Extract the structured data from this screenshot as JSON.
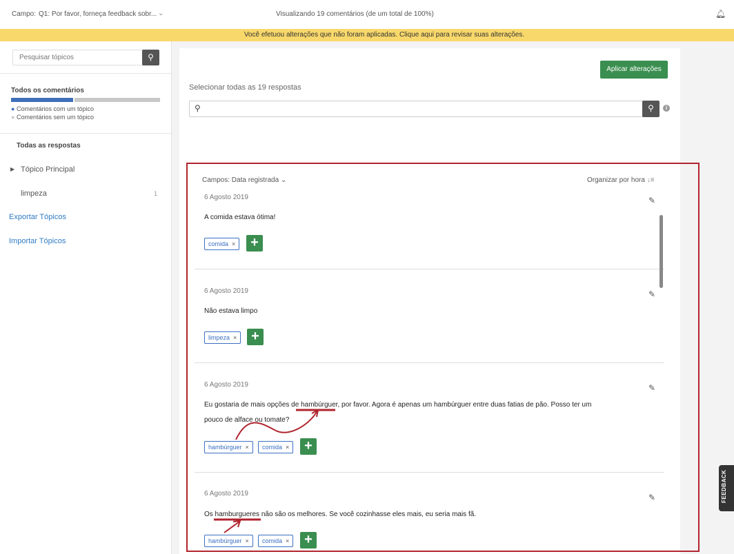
{
  "topbar": {
    "field_label": "Campo:",
    "field_value": "Q1: Por favor, forneça feedback sobr...",
    "viewing": "Visualizando 19 comentários (de um total de 100%)"
  },
  "banner": "Você efetuou alterações que não foram aplicadas. Clique aqui para revisar suas alterações.",
  "sidebar": {
    "search_placeholder": "Pesquisar tópicos",
    "all_comments": "Todos os comentários",
    "legend_with": "Comentários com um tópico",
    "legend_without": "Comentários sem um tópico",
    "coverage_percent": 50,
    "all_responses": "Todas as respostas",
    "main_topic": "Tópico Principal",
    "topics": [
      {
        "label": "limpeza",
        "count": "1"
      }
    ],
    "export": "Exportar Tópicos",
    "import": "Importar Tópicos"
  },
  "main": {
    "apply": "Aplicar alterações",
    "select_all": "Selecionar todas as 19 respostas",
    "fields": "Campos: Data registrada",
    "sort": "Organizar por hora",
    "comments": [
      {
        "date": "6 Agosto 2019",
        "text": "A comida estava ótima!",
        "tags": [
          "comida"
        ]
      },
      {
        "date": "6 Agosto 2019",
        "text": "Não estava limpo",
        "tags": [
          "limpeza"
        ]
      },
      {
        "date": "6 Agosto 2019",
        "text": "Eu gostaria de mais opções de hambúrguer, por favor. Agora é apenas um hambúrguer entre duas fatias de pão. Posso ter um pouco de alface ou tomate?",
        "tags": [
          "hambúrguer",
          "comida"
        ]
      },
      {
        "date": "6 Agosto 2019",
        "text": "Os hamburgueres não são os melhores. Se você cozinhasse eles mais, eu seria mais fã.",
        "tags": [
          "hambúrguer",
          "comida"
        ]
      }
    ]
  },
  "feedback": "FEEDBACK",
  "colors": {
    "accent": "#3b6fc4",
    "green": "#3a8e4f",
    "banner": "#f8d86b",
    "annotation": "#b0242e"
  }
}
